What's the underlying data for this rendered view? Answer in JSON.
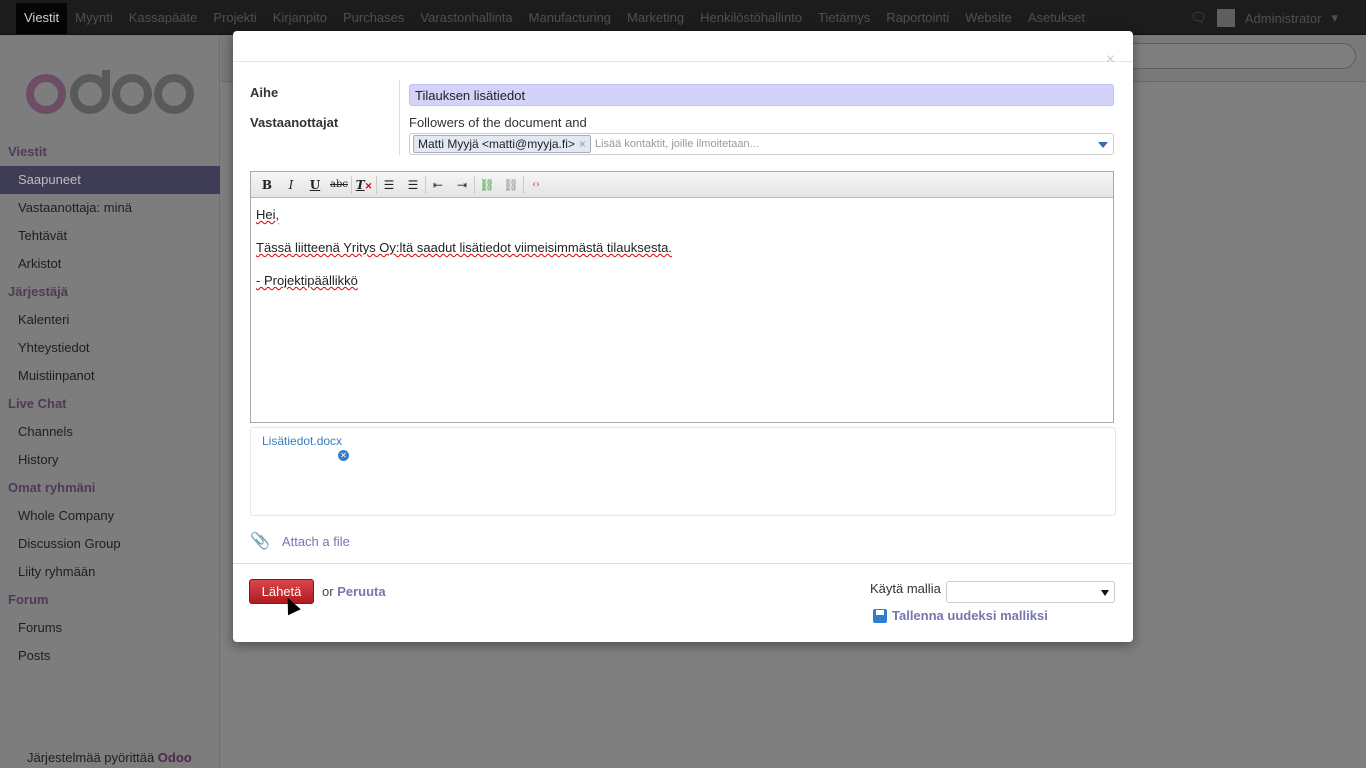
{
  "topnav": {
    "items": [
      "Viestit",
      "Myynti",
      "Kassapääte",
      "Projekti",
      "Kirjanpito",
      "Purchases",
      "Varastonhallinta",
      "Manufacturing",
      "Marketing",
      "Henkilöstöhallinto",
      "Tietämys",
      "Raportointi",
      "Website",
      "Asetukset"
    ],
    "active": "Viestit",
    "user": "Administrator"
  },
  "sidebar": {
    "logo": "odoo",
    "groups": [
      {
        "title": "Viestit",
        "items": [
          "Saapuneet",
          "Vastaanottaja: minä",
          "Tehtävät",
          "Arkistot"
        ]
      },
      {
        "title": "Järjestäjä",
        "items": [
          "Kalenteri",
          "Yhteystiedot",
          "Muistiinpanot"
        ]
      },
      {
        "title": "Live Chat",
        "items": [
          "Channels",
          "History"
        ]
      },
      {
        "title": "Omat ryhmäni",
        "items": [
          "Whole Company",
          "Discussion Group",
          "Liity ryhmään"
        ]
      },
      {
        "title": "Forum",
        "items": [
          "Forums",
          "Posts"
        ]
      }
    ],
    "active": "Saapuneet",
    "footer_prefix": "Järjestelmää pyörittää",
    "footer_brand": "Odoo"
  },
  "dialog": {
    "subject_label": "Aihe",
    "subject_value": "Tilauksen lisätiedot",
    "recipients_label": "Vastaanottajat",
    "followers_text": "Followers of the document and",
    "recipient_tag": "Matti Myyjä <matti@myyja.fi>",
    "recipient_placeholder": "Lisää kontaktit, joille ilmoitetaan...",
    "toolbar": [
      "bold",
      "italic",
      "underline",
      "strikethrough",
      "remove-format",
      "bullet-list",
      "numbered-list",
      "outdent",
      "indent",
      "link",
      "unlink",
      "source"
    ],
    "body": [
      "Hei,",
      "Tässä liitteenä Yritys Oy:ltä saadut lisätiedot viimeisimmästä tilauksesta.",
      "- Projektipäällikkö"
    ],
    "attachment": "Lisätiedot.docx",
    "attach_label": "Attach a file",
    "send_label": "Lähetä",
    "or_label": "or",
    "cancel_label": "Peruuta",
    "template_label": "Käytä mallia",
    "template_value": "",
    "save_template_label": "Tallenna uudeksi malliksi"
  }
}
